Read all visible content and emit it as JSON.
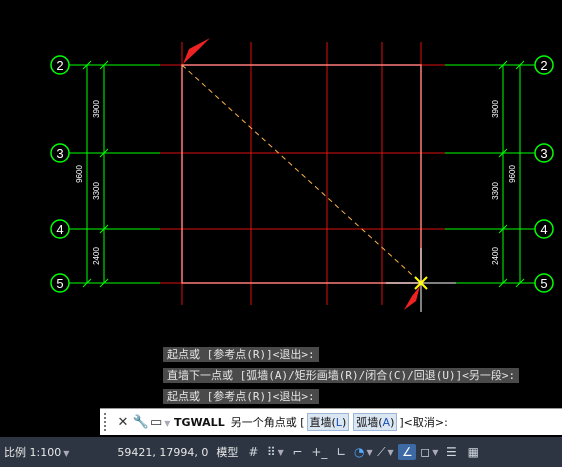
{
  "drawing": {
    "axes": [
      {
        "label": "2"
      },
      {
        "label": "3"
      },
      {
        "label": "4"
      },
      {
        "label": "5"
      }
    ],
    "dims_left_segments": [
      "3900",
      "3300",
      "2400"
    ],
    "dims_left_total": "9600",
    "dims_right_segments": [
      "3900",
      "3300",
      "2400"
    ],
    "dims_right_total": "9600",
    "colors": {
      "axis_line": "#00ff00",
      "grid_line": "#ff0000",
      "wall_rect": "#ff6a6a",
      "rubberband": "#ffb347",
      "cursor": "#ffff00",
      "arrow": "#ee2222"
    }
  },
  "command_history": [
    "起点或 [参考点(R)]<退出>:",
    "直墙下一点或 [弧墙(A)/矩形画墙(R)/闭合(C)/回退(U)]<另一段>:",
    "起点或 [参考点(R)]<退出>:"
  ],
  "command_line": {
    "command": "TGWALL",
    "prompt": "另一个角点或 [",
    "options": [
      {
        "label": "直墙",
        "key": "L"
      },
      {
        "label": "弧墙",
        "key": "A"
      }
    ],
    "suffix": "]<取消>:"
  },
  "status_bar": {
    "scale_label": "比例 1:100",
    "coordinates": "59421, 17994, 0",
    "model_label": "模型"
  }
}
